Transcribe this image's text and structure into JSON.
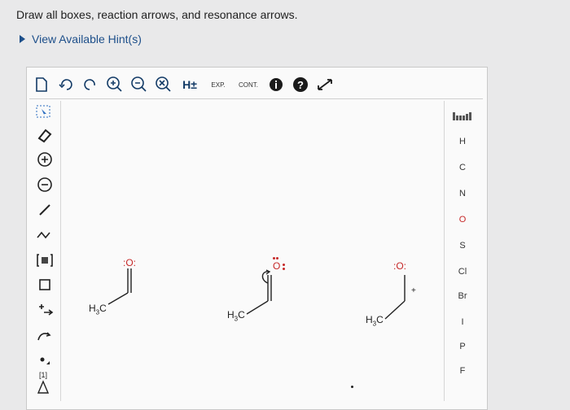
{
  "question": "Draw all boxes, reaction arrows, and resonance arrows.",
  "hint_link": "View Available Hint(s)",
  "toolbar": {
    "h_label": "H±",
    "exp_label": "EXP.",
    "cont_label": "CONT."
  },
  "elements": [
    "H",
    "C",
    "N",
    "O",
    "S",
    "Cl",
    "Br",
    "I",
    "P",
    "F"
  ],
  "left_tools": {
    "charge_plus": "+",
    "charge_minus": "−",
    "footnote": "[1]"
  },
  "molecules": [
    {
      "methyl": "H",
      "methyl_sub": "3",
      "methyl_end": "C",
      "atom": "O",
      "lone_pairs": ":O:"
    },
    {
      "methyl": "H",
      "methyl_sub": "3",
      "methyl_end": "C",
      "atom": "O"
    },
    {
      "methyl": "H",
      "methyl_sub": "3",
      "methyl_end": "C",
      "atom": "O",
      "lone_pairs": ":O:",
      "charge": "+"
    }
  ],
  "colors": {
    "accent": "#1d4f8a",
    "red": "#c62828"
  }
}
